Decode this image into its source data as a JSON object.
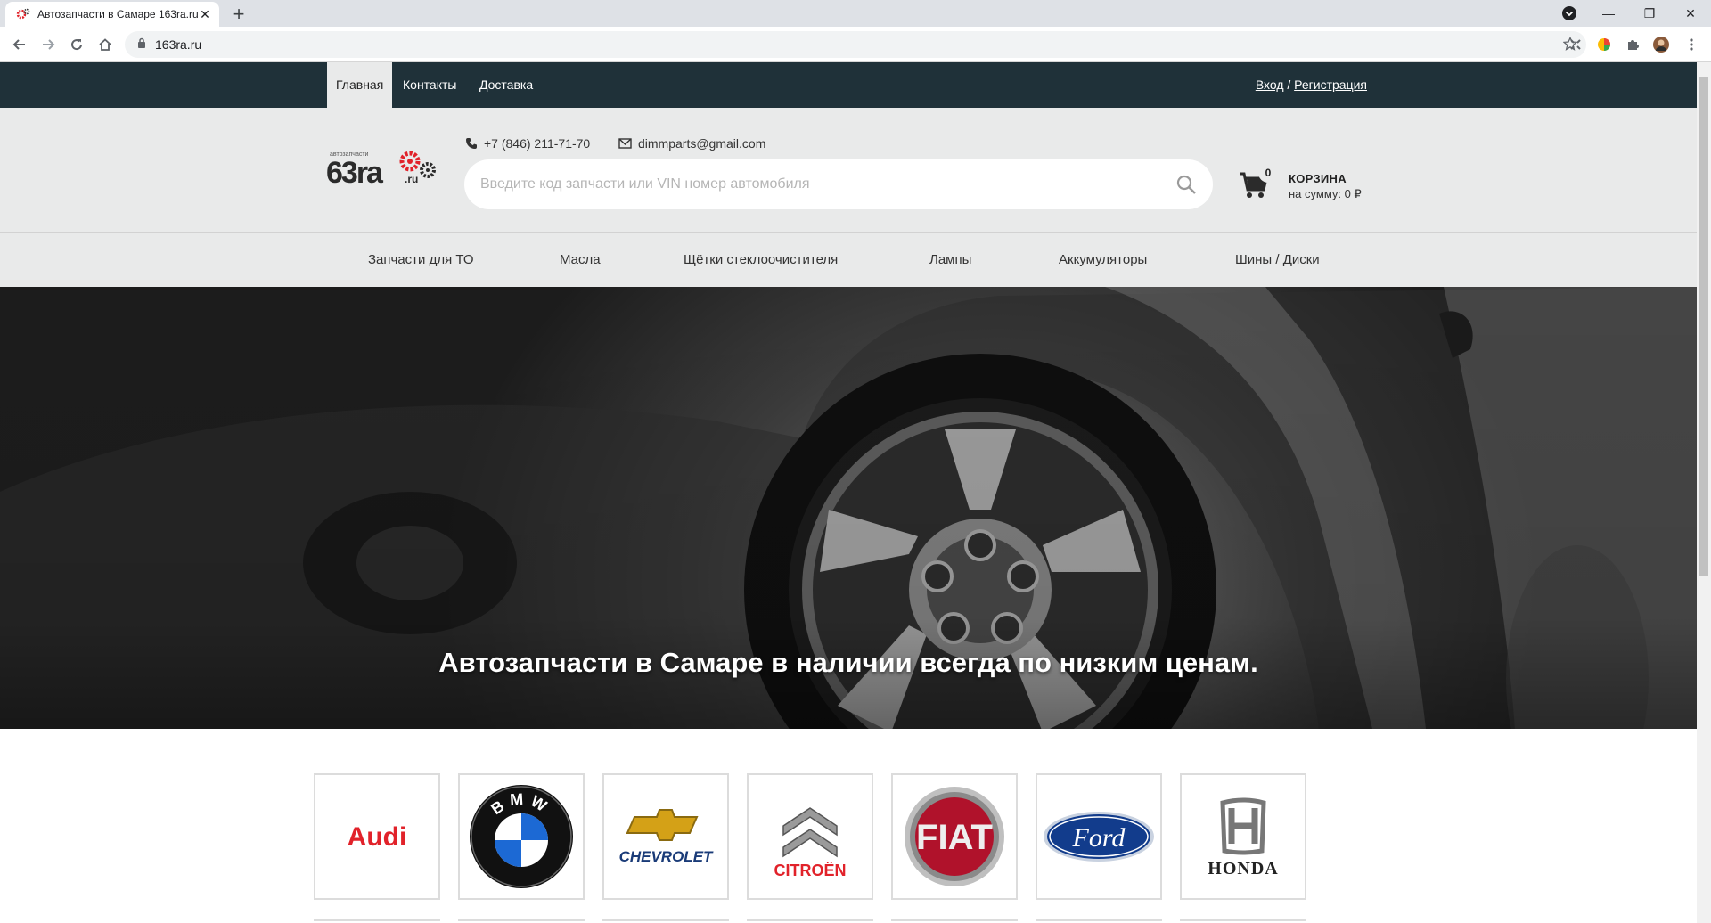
{
  "browser": {
    "tab_title": "Автозапчасти в Самаре 163ra.ru",
    "url": "163ra.ru",
    "favicon": "gears-icon"
  },
  "site": {
    "nav": {
      "home": "Главная",
      "contacts": "Контакты",
      "delivery": "Доставка",
      "login": "Вход",
      "separator": " / ",
      "register": "Регистрация"
    },
    "header": {
      "logo_small": "автозапчасти",
      "logo_main": "63ra",
      "logo_tld": ".ru",
      "phone": "+7 (846) 211-71-70",
      "email": "dimmparts@gmail.com",
      "search_placeholder": "Введите код запчасти или VIN номер автомобиля",
      "cart_count": "0",
      "cart_title": "КОРЗИНА",
      "cart_sum": "на сумму: 0 ₽"
    },
    "categories": [
      "Запчасти для ТО",
      "Масла",
      "Щётки стеклоочистителя",
      "Лампы",
      "Аккумуляторы",
      "Шины / Диски"
    ],
    "hero_text": "Автозапчасти в Самаре в наличии всегда по низким ценам.",
    "brands": {
      "audi": "Audi",
      "bmw": "BMW",
      "chevrolet": "CHEVROLET",
      "citroen": "CITROËN",
      "fiat": "FIAT",
      "ford": "Ford",
      "honda": "HONDA"
    }
  },
  "colors": {
    "topnav_bg": "#1f3139",
    "header_bg": "#e9eaea",
    "accent_red": "#e1222a"
  }
}
